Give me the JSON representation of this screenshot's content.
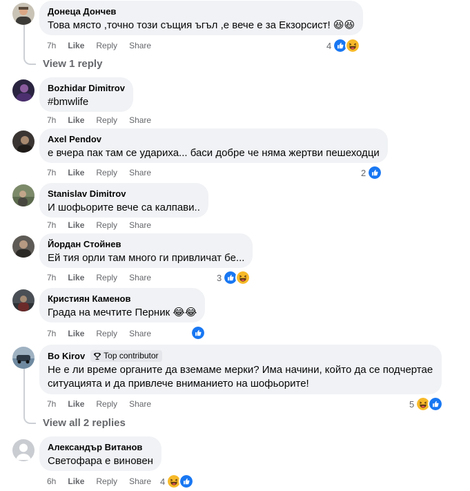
{
  "actions": {
    "like": "Like",
    "reply": "Reply",
    "share": "Share"
  },
  "colors": {
    "like_blue": "#1877f2",
    "haha_yellow": "#f7b928",
    "bubble": "#f0f2f5",
    "meta": "#65676b"
  },
  "comments": [
    {
      "author": "Донеца Дончев",
      "text": "Това място ,точно този същия ъгъл ,е вече е за Екзорсист! 😆😆",
      "time": "7h",
      "reactions": {
        "count": "4",
        "icons": [
          "like-icon",
          "haha-icon"
        ]
      }
    },
    {
      "author": "Bozhidar Dimitrov",
      "text": "#bmwlife",
      "time": "7h",
      "reactions": null
    },
    {
      "author": "Axel Pendov",
      "text": "е вчера пак там се удариха... баси добре че няма жертви пешеходци",
      "time": "7h",
      "reactions": {
        "count": "2",
        "icons": [
          "like-icon"
        ]
      }
    },
    {
      "author": "Stanislav Dimitrov",
      "text": "И шофьорите вече са калпави..",
      "time": "7h",
      "reactions": null
    },
    {
      "author": "Йордан Стойнев",
      "text": "Ей тия орли там много ги привличат бе...",
      "time": "7h",
      "reactions": {
        "count": "3",
        "icons": [
          "like-icon",
          "haha-icon"
        ]
      }
    },
    {
      "author": "Кристиян Каменов",
      "text": "Града на мечтите Перник 😂😂",
      "time": "7h",
      "reactions": {
        "count": "",
        "icons": [
          "like-icon"
        ]
      }
    },
    {
      "author": "Bo Kirov",
      "badge": "Top contributor",
      "text": "Не е ли време органите да вземаме мерки? Има начини, който да се подчертае ситуацията и да привлече вниманието на шофьорите!",
      "time": "7h",
      "reactions": {
        "count": "5",
        "icons": [
          "haha-icon",
          "like-icon"
        ]
      }
    },
    {
      "author": "Александър Витанов",
      "text": "Светофара е виновен",
      "time": "6h",
      "reactions": {
        "count": "4",
        "icons": [
          "haha-icon",
          "like-icon"
        ]
      }
    }
  ],
  "view_replies": [
    "View 1 reply",
    "View all 2 replies"
  ]
}
